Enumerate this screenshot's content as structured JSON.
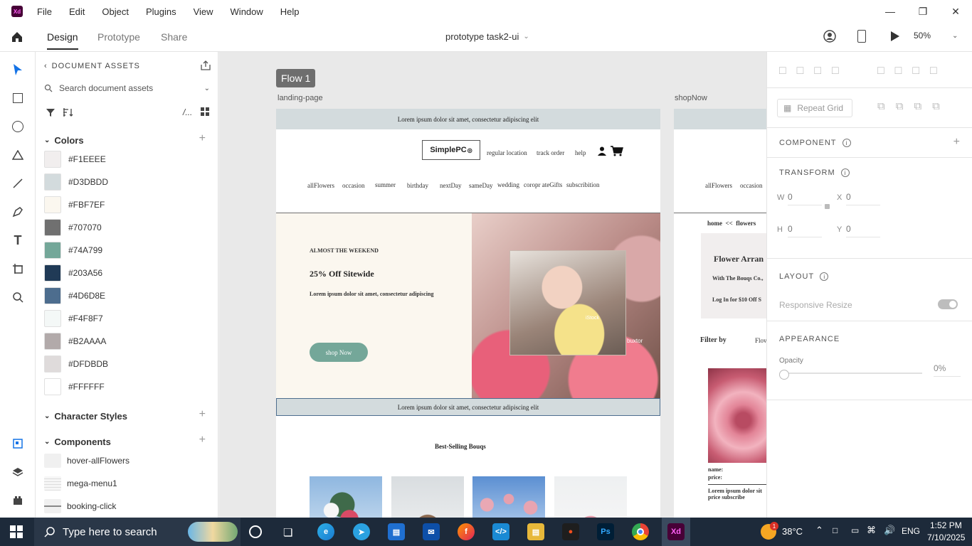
{
  "app": {
    "logo": "Xd"
  },
  "menu": [
    "File",
    "Edit",
    "Object",
    "Plugins",
    "View",
    "Window",
    "Help"
  ],
  "header": {
    "tabs": [
      "Design",
      "Prototype",
      "Share"
    ],
    "document_title": "prototype task2-ui",
    "zoom": "50%"
  },
  "assets": {
    "title": "DOCUMENT ASSETS",
    "search_placeholder": "Search document assets",
    "colors_heading": "Colors",
    "colors": [
      {
        "label": "#F1EEEE",
        "hex": "#F1EEEE"
      },
      {
        "label": "#D3DBDD",
        "hex": "#D3DBDD"
      },
      {
        "label": "#FBF7EF",
        "hex": "#FBF7EF"
      },
      {
        "label": "#707070",
        "hex": "#707070"
      },
      {
        "label": "#74A799",
        "hex": "#74A799"
      },
      {
        "label": "#203A56",
        "hex": "#203A56"
      },
      {
        "label": "#4D6D8E",
        "hex": "#4D6D8E"
      },
      {
        "label": "#F4F8F7",
        "hex": "#F4F8F7"
      },
      {
        "label": "#B2AAAA",
        "hex": "#B2AAAA"
      },
      {
        "label": "#DFDBDB",
        "hex": "#DFDBDB"
      },
      {
        "label": "#FFFFFF",
        "hex": "#FFFFFF"
      }
    ],
    "character_styles_heading": "Character Styles",
    "components_heading": "Components",
    "components": [
      "hover-allFlowers",
      "mega-menu1",
      "booking-click"
    ]
  },
  "canvas": {
    "flow_label": "Flow 1",
    "artboard1": {
      "name": "landing-page",
      "top_banner": "Lorem ipsum dolor sit amet, consectetur adipiscing elit",
      "logo": "SimplePC",
      "nav_right": [
        "regular location",
        "track order",
        "help"
      ],
      "categories": [
        "allFlowers",
        "occasion",
        "summer",
        "birthday",
        "nextDay",
        "sameDay",
        "wedding",
        "coropr ateGifts",
        "subscribition"
      ],
      "hero_kicker": "ALMOST THE WEEKEND",
      "hero_title": "25% Off Sitewide",
      "hero_text": "Lorem ipsum dolor sit amet, consectetur adipiscing",
      "hero_button": "shop Now",
      "photo_caption_1": "iStock",
      "photo_caption_2": "buxtor",
      "mid_banner": "Lorem ipsum dolor sit amet, consectetur adipiscing elit",
      "best_selling": "Best-Selling Bouqs"
    },
    "artboard2": {
      "name": "shopNow",
      "categories": [
        "allFlowers",
        "occasion"
      ],
      "breadcrumb": "home  <<  flowers",
      "box_title": "Flower Arran",
      "box_line1": "With The Bouqs Co.,",
      "box_line2": "Log In for $10 Off S",
      "filter": "Filter by",
      "filter2": "Flov",
      "product_name": "name:",
      "product_price": "price:",
      "product_desc1": "Lorem ipsum dolor sit",
      "product_desc2": "price subscribe"
    }
  },
  "props": {
    "repeat_grid": "Repeat Grid",
    "component": "COMPONENT",
    "transform": "TRANSFORM",
    "w_label": "W",
    "w": "0",
    "x_label": "X",
    "x": "0",
    "h_label": "H",
    "h": "0",
    "y_label": "Y",
    "y": "0",
    "layout": "LAYOUT",
    "responsive_resize": "Responsive Resize",
    "appearance": "APPEARANCE",
    "opacity_label": "Opacity",
    "opacity": "0%"
  },
  "taskbar": {
    "search_placeholder": "Type here to search",
    "temperature": "38°C",
    "language": "ENG",
    "time": "1:52 PM",
    "date": "7/10/2025",
    "weather_badge": "1"
  }
}
